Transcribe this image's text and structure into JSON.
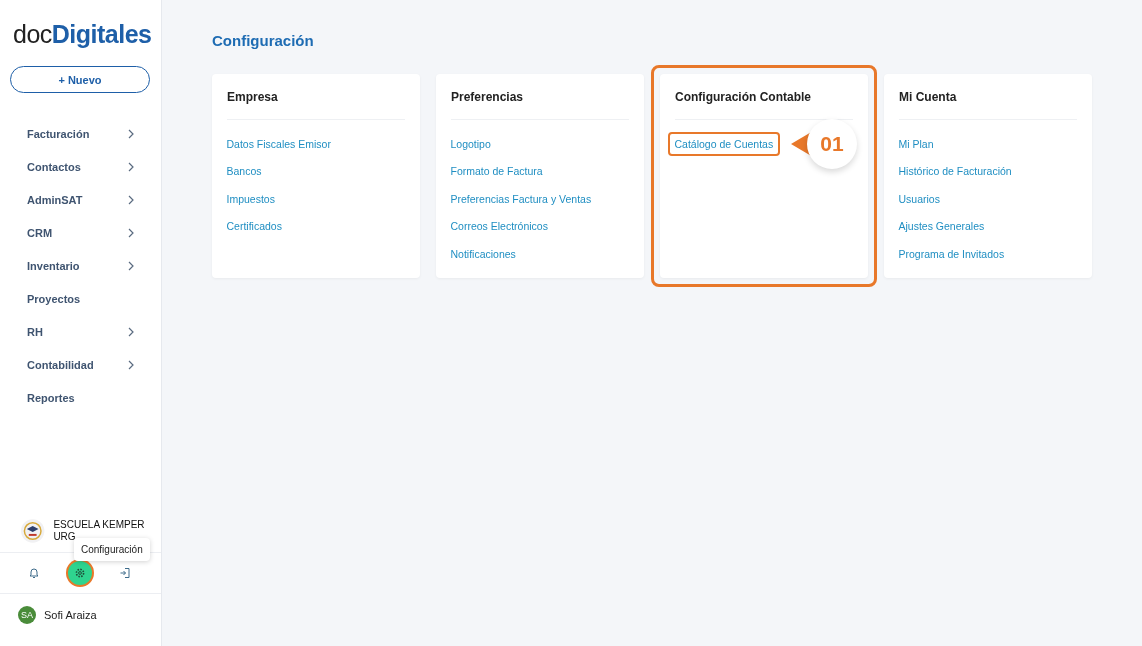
{
  "sidebar": {
    "logo": "doc**Digitales**",
    "new_button": "+ Nuevo",
    "items": [
      {
        "label": "Facturación",
        "has_submenu": true
      },
      {
        "label": "Contactos",
        "has_submenu": true
      },
      {
        "label": "AdminSAT",
        "has_submenu": true
      },
      {
        "label": "CRM",
        "has_submenu": true
      },
      {
        "label": "Inventario",
        "has_submenu": true
      },
      {
        "label": "Proyectos",
        "has_submenu": false
      },
      {
        "label": "RH",
        "has_submenu": true
      },
      {
        "label": "Contabilidad",
        "has_submenu": true
      },
      {
        "label": "Reportes",
        "has_submenu": false
      }
    ],
    "company": "ESCUELA KEMPER URG",
    "tooltip": "Configuración",
    "footer_icons": [
      {
        "kind": "bell",
        "selected": false
      },
      {
        "kind": "gear",
        "selected": true
      },
      {
        "kind": "logout",
        "selected": false
      }
    ],
    "user": {
      "initials": "SA",
      "name": "Sofi Araiza"
    }
  },
  "page_title": "Configuración",
  "cards": [
    {
      "title": "Empresa",
      "highlighted": false,
      "links": [
        {
          "label": "Datos Fiscales Emisor",
          "highlighted": false
        },
        {
          "label": "Bancos",
          "highlighted": false
        },
        {
          "label": "Impuestos",
          "highlighted": false
        },
        {
          "label": "Certificados",
          "highlighted": false
        }
      ]
    },
    {
      "title": "Preferencias",
      "highlighted": false,
      "links": [
        {
          "label": "Logotipo",
          "highlighted": false
        },
        {
          "label": "Formato de Factura",
          "highlighted": false
        },
        {
          "label": "Preferencias Factura y Ventas",
          "highlighted": false
        },
        {
          "label": "Correos Electrónicos",
          "highlighted": false
        },
        {
          "label": "Notificaciones",
          "highlighted": false
        }
      ]
    },
    {
      "title": "Configuración Contable",
      "highlighted": true,
      "callout": "01",
      "links": [
        {
          "label": "Catálogo de Cuentas",
          "highlighted": true
        }
      ]
    },
    {
      "title": "Mi Cuenta",
      "highlighted": false,
      "links": [
        {
          "label": "Mi Plan",
          "highlighted": false
        },
        {
          "label": "Histórico de Facturación",
          "highlighted": false
        },
        {
          "label": "Usuarios",
          "highlighted": false
        },
        {
          "label": "Ajustes Generales",
          "highlighted": false
        },
        {
          "label": "Programa de Invitados",
          "highlighted": false
        }
      ]
    }
  ]
}
